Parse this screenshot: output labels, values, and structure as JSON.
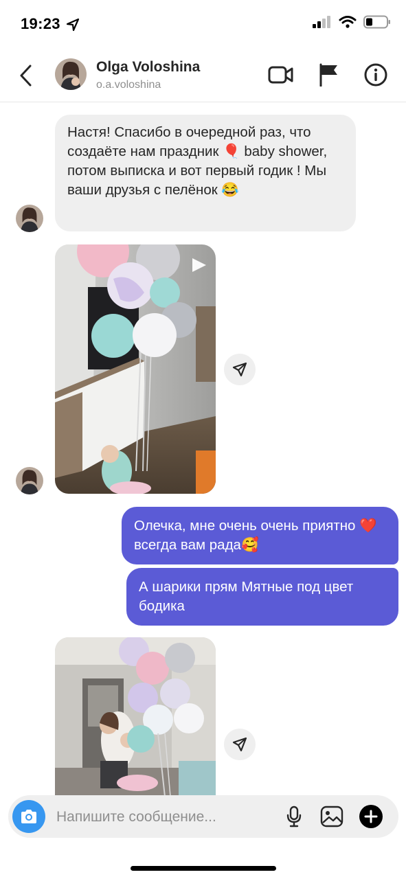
{
  "status_bar": {
    "time": "19:23"
  },
  "header": {
    "name": "Olga Voloshina",
    "username": "o.a.voloshina"
  },
  "messages": {
    "incoming_1": "Настя! Спасибо в очередной раз, что создаёте нам праздник 🎈 baby shower, потом выписка и вот первый годик ! Мы ваши друзья с пелёнок 😂",
    "outgoing_1": "Олечка, мне очень очень приятно ❤️ всегда вам рада🥰",
    "outgoing_2": "А шарики прям Мятные под цвет бодика"
  },
  "composer": {
    "placeholder": "Напишите сообщение..."
  },
  "colors": {
    "outgoing_bubble": "#5b5bd6",
    "incoming_bubble": "#efefef",
    "camera_button": "#3797f0"
  }
}
